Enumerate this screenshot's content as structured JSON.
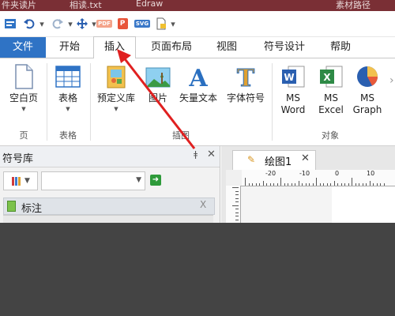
{
  "titlebar": {
    "text_left": "件夹读片",
    "text_mid": "相读.txt",
    "text_right": "Edraw",
    "text_far": "素材路径"
  },
  "quick_access": {
    "pdf_label": "PDF",
    "p_label": "P",
    "svg_label": "SVG",
    "menu_glyph": "▾"
  },
  "tabs": [
    {
      "label": "文件"
    },
    {
      "label": "开始"
    },
    {
      "label": "插入"
    },
    {
      "label": "页面布局"
    },
    {
      "label": "视图"
    },
    {
      "label": "符号设计"
    },
    {
      "label": "帮助"
    }
  ],
  "ribbon": {
    "blank_page": "空白页",
    "table": "表格",
    "predefined_lib": "预定义库",
    "picture": "图片",
    "vector_text": "矢量文本",
    "font_symbol": "字体符号",
    "ms_word_1": "MS",
    "ms_word_2": "Word",
    "ms_excel_1": "MS",
    "ms_excel_2": "Excel",
    "ms_graph_1": "MS",
    "ms_graph_2": "Graph",
    "groups": {
      "page": "页",
      "table": "表格",
      "illustration": "插图",
      "object": "对象"
    }
  },
  "symbol_panel": {
    "title": "符号库",
    "pin": "ǂ",
    "close": "✕",
    "library_item": "标注",
    "item_close": "X"
  },
  "document": {
    "tab_label": "绘图1",
    "tab_close": "✕",
    "ruler_labels": [
      "-20",
      "-10",
      "0",
      "10"
    ]
  },
  "colors": {
    "file_tab": "#2f73c5",
    "annotation_arrow": "#e02020",
    "title_strip": "#7a2f35"
  }
}
